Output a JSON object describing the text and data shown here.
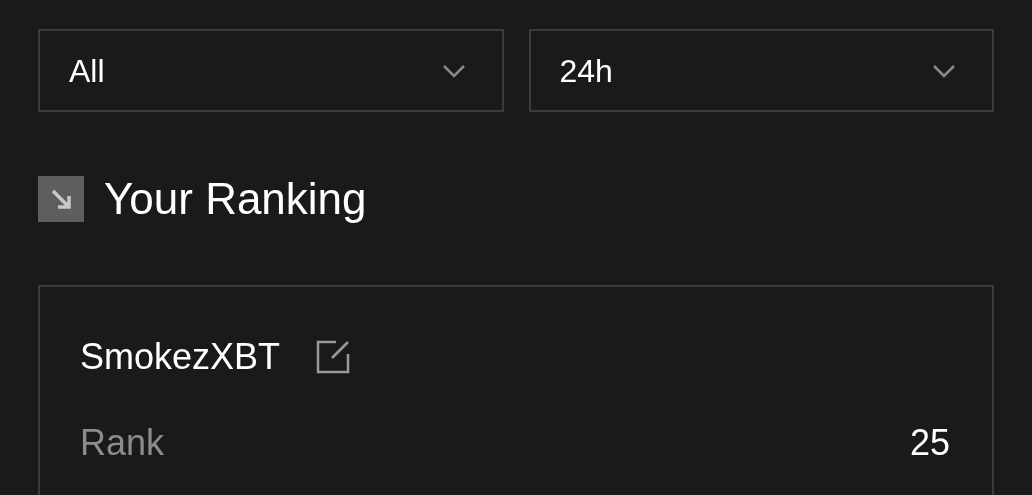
{
  "filters": [
    {
      "value": "All"
    },
    {
      "value": "24h"
    }
  ],
  "section": {
    "title": "Your Ranking"
  },
  "card": {
    "username": "SmokezXBT",
    "rows": [
      {
        "label": "Rank",
        "value": "25"
      }
    ]
  }
}
